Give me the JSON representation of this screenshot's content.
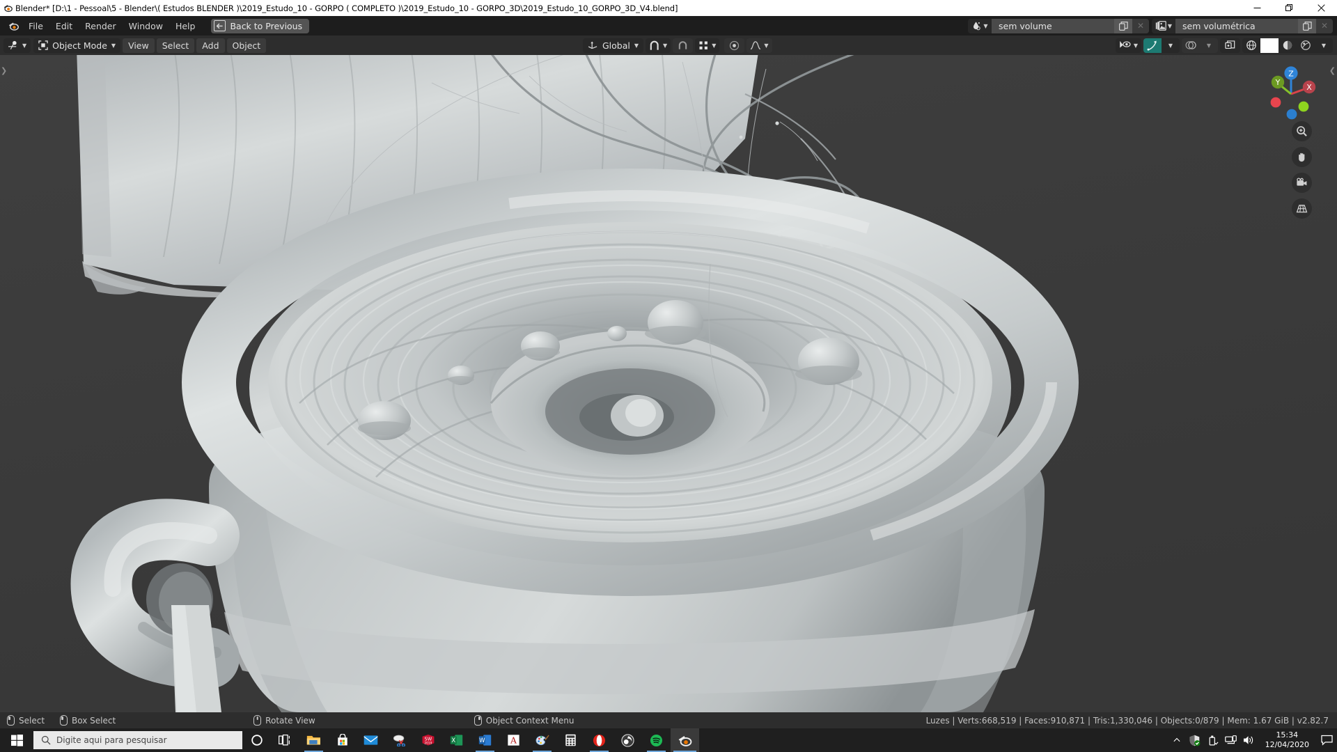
{
  "window": {
    "title": "Blender* [D:\\1 - Pessoal\\5 - Blender\\( Estudos BLENDER )\\2019_Estudo_10 - GORPO ( COMPLETO )\\2019_Estudo_10 - GORPO_3D\\2019_Estudo_10_GORPO_3D_V4.blend]",
    "minimize_label": "Minimize",
    "restore_label": "Restore",
    "close_label": "Close"
  },
  "topbar": {
    "menus": [
      "File",
      "Edit",
      "Render",
      "Window",
      "Help"
    ],
    "back_to_previous": "Back to Previous",
    "scene": {
      "name": "sem volume",
      "icon": "scene-icon"
    },
    "view_layer": {
      "name": "sem volumétrica",
      "icon": "view-layer-icon"
    }
  },
  "viewport_header": {
    "editor_type": "editor-type-3d-viewport",
    "mode": "Object Mode",
    "menus": [
      "View",
      "Select",
      "Add",
      "Object"
    ],
    "transform_orientation": "Global",
    "snap": "snap-magnet",
    "snap_target": "snap-vertex",
    "proportional_editing": "proportional-edit-off",
    "falloff": "smooth-falloff",
    "visibility": "object-types-visibility",
    "gizmo": "gizmo-toggle",
    "overlays": "overlays-toggle",
    "xray": "toggle-xray",
    "shading_modes": [
      "wireframe",
      "solid",
      "material-preview",
      "rendered"
    ],
    "active_shading": "solid"
  },
  "viewport": {
    "background_color": "#3b3b3b",
    "gizmo": {
      "axes": [
        "X",
        "Y",
        "Z"
      ],
      "x_color": "#d9434a",
      "y_color": "#85c22a",
      "z_color": "#2f84d8"
    },
    "nav_tools": [
      "zoom-icon",
      "pan-hand-icon",
      "camera-icon",
      "ortho-grid-icon"
    ]
  },
  "statusbar": {
    "hints": [
      {
        "icon": "mouse-left",
        "label": "Select"
      },
      {
        "icon": "mouse-drag",
        "label": "Box Select"
      },
      {
        "icon": "mouse-middle",
        "label": "Rotate View"
      },
      {
        "icon": "mouse-right",
        "label": "Object Context Menu"
      }
    ],
    "stats": "Luzes | Verts:668,519 | Faces:910,871 | Tris:1,330,046 | Objects:0/879 | Mem: 1.67 GiB | v2.82.7"
  },
  "taskbar": {
    "start_label": "Start",
    "search_placeholder": "Digite aqui para pesquisar",
    "items": [
      {
        "name": "cortana-icon",
        "open": false
      },
      {
        "name": "task-view-icon",
        "open": false
      },
      {
        "name": "file-explorer-icon",
        "open": true
      },
      {
        "name": "microsoft-store-icon",
        "open": false
      },
      {
        "name": "mail-icon",
        "open": false
      },
      {
        "name": "snipping-tool-icon",
        "open": false
      },
      {
        "name": "solidworks-icon",
        "open": false
      },
      {
        "name": "excel-icon",
        "open": false
      },
      {
        "name": "word-icon",
        "open": true
      },
      {
        "name": "autocad-icon",
        "open": false
      },
      {
        "name": "paint-icon",
        "open": true
      },
      {
        "name": "calculator-icon",
        "open": false
      },
      {
        "name": "opera-icon",
        "open": true
      },
      {
        "name": "obs-icon",
        "open": false
      },
      {
        "name": "spotify-icon",
        "open": true
      },
      {
        "name": "blender-icon",
        "open": true,
        "active": true
      }
    ],
    "tray": [
      "show-hidden-icons",
      "windows-security-icon",
      "usb-eject-icon",
      "network-icon",
      "volume-icon"
    ],
    "clock": {
      "time": "15:34",
      "date": "12/04/2020"
    },
    "notifications": "action-center-icon"
  }
}
